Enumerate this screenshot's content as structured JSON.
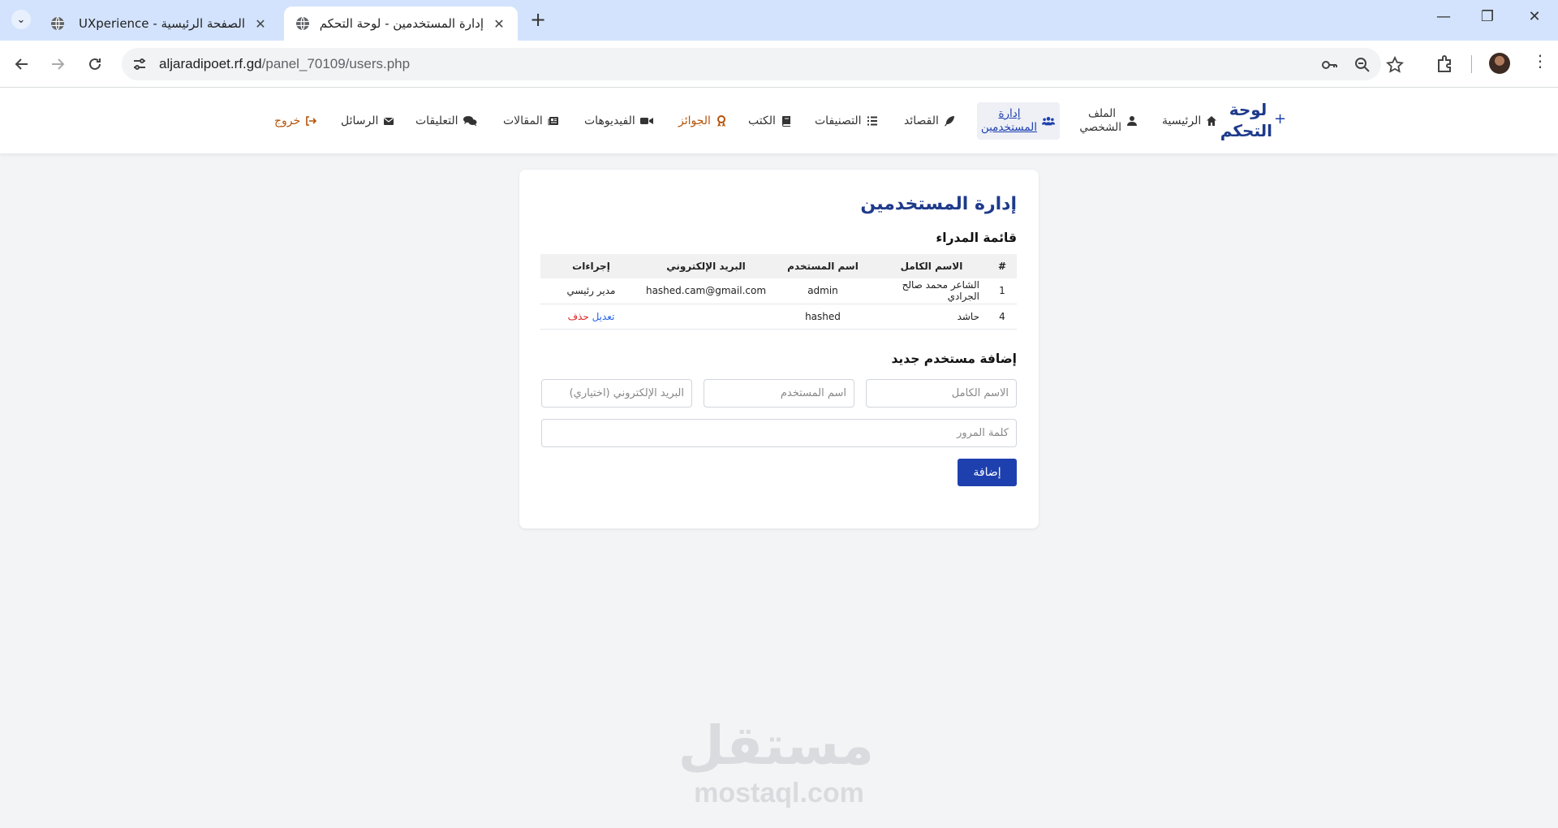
{
  "browser": {
    "tabs": [
      {
        "title": "الصفحة الرئيسية - UXperience",
        "active": false
      },
      {
        "title": "إدارة المستخدمين - لوحة التحكم",
        "active": true
      }
    ],
    "new_tab": "+",
    "close": "✕",
    "url_host": "aljaradipoet.rf.gd",
    "url_path": "/panel_70109/users.php",
    "window_controls": {
      "minimize": "—",
      "restore": "❐",
      "close": "✕"
    }
  },
  "nav": {
    "brand": "لوحة التحكم",
    "brand_plus": "+",
    "items": [
      {
        "label": "الرئيسية",
        "icon": "home-icon"
      },
      {
        "label": "الملف الشخصي",
        "icon": "user-icon"
      },
      {
        "label": "إدارة المستخدمين",
        "icon": "users-icon",
        "active": true
      },
      {
        "label": "القصائد",
        "icon": "feather-icon"
      },
      {
        "label": "التصنيفات",
        "icon": "list-icon"
      },
      {
        "label": "الكتب",
        "icon": "book-icon"
      },
      {
        "label": "الجوائز",
        "icon": "award-icon"
      },
      {
        "label": "الفيديوهات",
        "icon": "video-icon"
      },
      {
        "label": "المقالات",
        "icon": "newspaper-icon"
      },
      {
        "label": "التعليقات",
        "icon": "comments-icon"
      },
      {
        "label": "الرسائل",
        "icon": "envelope-icon"
      },
      {
        "label": "خروج",
        "icon": "logout-icon"
      }
    ]
  },
  "main": {
    "title": "إدارة المستخدمين",
    "admins_title": "قائمة المدراء",
    "table": {
      "headers": [
        "#",
        "الاسم الكامل",
        "اسم المستخدم",
        "البريد الإلكتروني",
        "إجراءات"
      ],
      "rows": [
        {
          "id": "1",
          "full_name": "الشاعر محمد صالح الجرادي",
          "username": "admin",
          "email": "hashed.cam@gmail.com",
          "action_note": "مدير رئيسي"
        },
        {
          "id": "4",
          "full_name": "حاشد",
          "username": "hashed",
          "email": "",
          "edit": "تعديل",
          "delete": "حذف"
        }
      ]
    },
    "add_title": "إضافة مستخدم جديد",
    "form": {
      "full_name_placeholder": "الاسم الكامل",
      "username_placeholder": "اسم المستخدم",
      "email_placeholder": "البريد الإلكتروني (اختياري)",
      "password_placeholder": "كلمة المرور",
      "submit": "إضافة"
    }
  },
  "watermark": {
    "arabic": "مستقل",
    "latin": "mostaql.com"
  },
  "colors": {
    "brand": "#1e3a8a",
    "button": "#1e40af",
    "logout": "#b45309",
    "delete": "#dc2626",
    "edit": "#2563eb"
  }
}
